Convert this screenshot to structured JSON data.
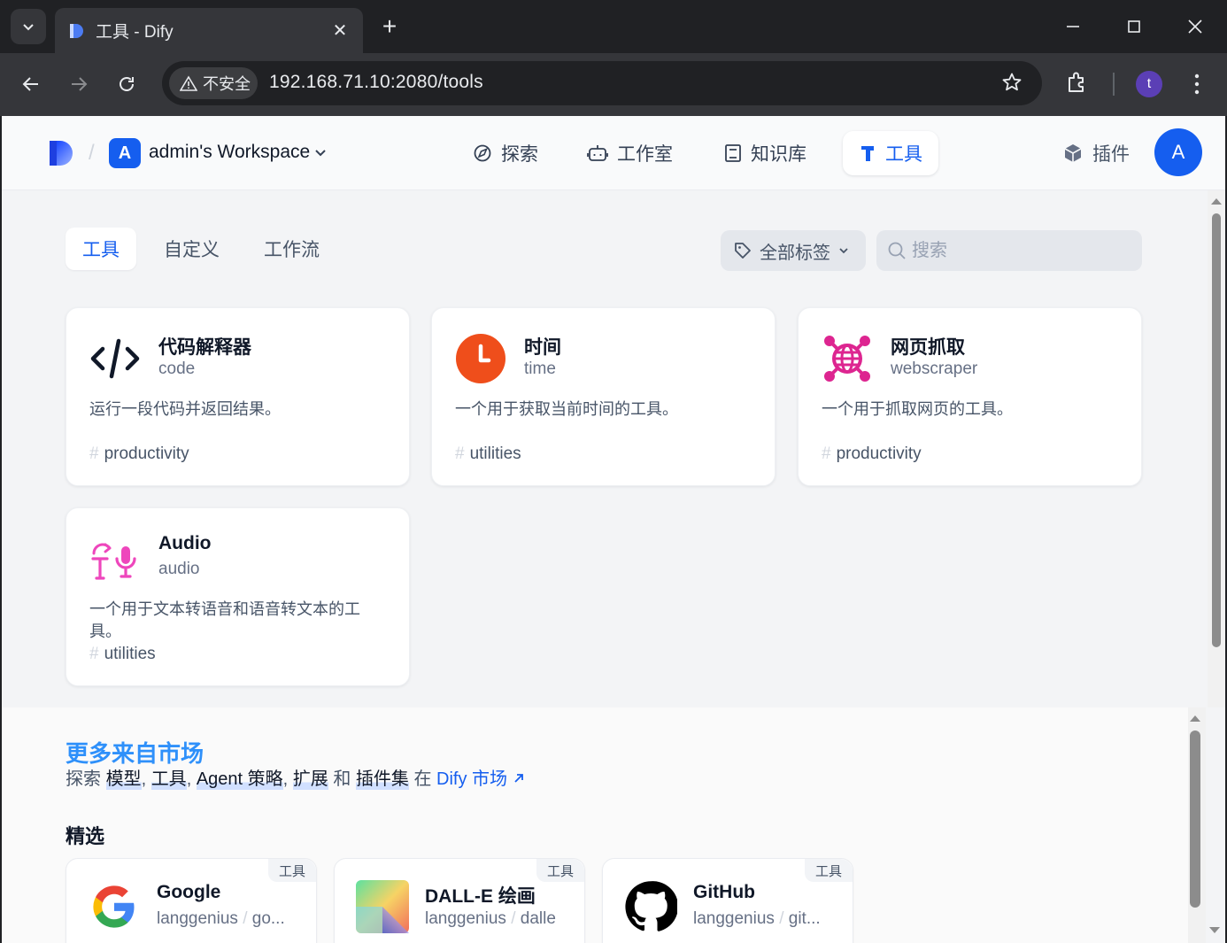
{
  "browser": {
    "tab_title": "工具 - Dify",
    "security_label": "不安全",
    "url": "192.168.71.10:2080/tools",
    "profile_initial": "t"
  },
  "header": {
    "workspace_initial": "A",
    "workspace_name": "admin's Workspace",
    "nav": {
      "explore": "探索",
      "studio": "工作室",
      "knowledge": "知识库",
      "tools": "工具"
    },
    "plugins": "插件",
    "avatar_initial": "A"
  },
  "tools": {
    "subtabs": [
      "工具",
      "自定义",
      "工作流"
    ],
    "tag_filter": "全部标签",
    "search_placeholder": "搜索",
    "cards": [
      {
        "title": "代码解释器",
        "subtitle": "code",
        "desc": "运行一段代码并返回结果。",
        "tag": "productivity",
        "icon": "code-icon"
      },
      {
        "title": "时间",
        "subtitle": "time",
        "desc": "一个用于获取当前时间的工具。",
        "tag": "utilities",
        "icon": "clock-icon"
      },
      {
        "title": "网页抓取",
        "subtitle": "webscraper",
        "desc": "一个用于抓取网页的工具。",
        "tag": "productivity",
        "icon": "globe-network-icon"
      },
      {
        "title": "Audio",
        "subtitle": "audio",
        "desc": "一个用于文本转语音和语音转文本的工具。",
        "tag": "utilities",
        "icon": "audio-icon"
      }
    ]
  },
  "market": {
    "title": "更多来自市场",
    "sub_prefix": "探索",
    "models": "模型",
    "tools": "工具",
    "agent": "Agent 策略",
    "ext": "扩展",
    "and": "和",
    "bundles": "插件集",
    "in": "在",
    "link": "Dify 市场",
    "featured": "精选",
    "cards": [
      {
        "title": "Google",
        "org": "langgenius",
        "name": "go...",
        "badge": "工具",
        "icon": "google-icon"
      },
      {
        "title": "DALL-E 绘画",
        "org": "langgenius",
        "name": "dalle",
        "badge": "工具",
        "icon": "dalle-icon"
      },
      {
        "title": "GitHub",
        "org": "langgenius",
        "name": "git...",
        "badge": "工具",
        "icon": "github-icon"
      }
    ]
  },
  "colors": {
    "primary": "#155eef",
    "market_title": "#2e90fa",
    "clock": "#ef4e1b",
    "webscraper": "#dd2590",
    "audio": "#ee46bc"
  }
}
